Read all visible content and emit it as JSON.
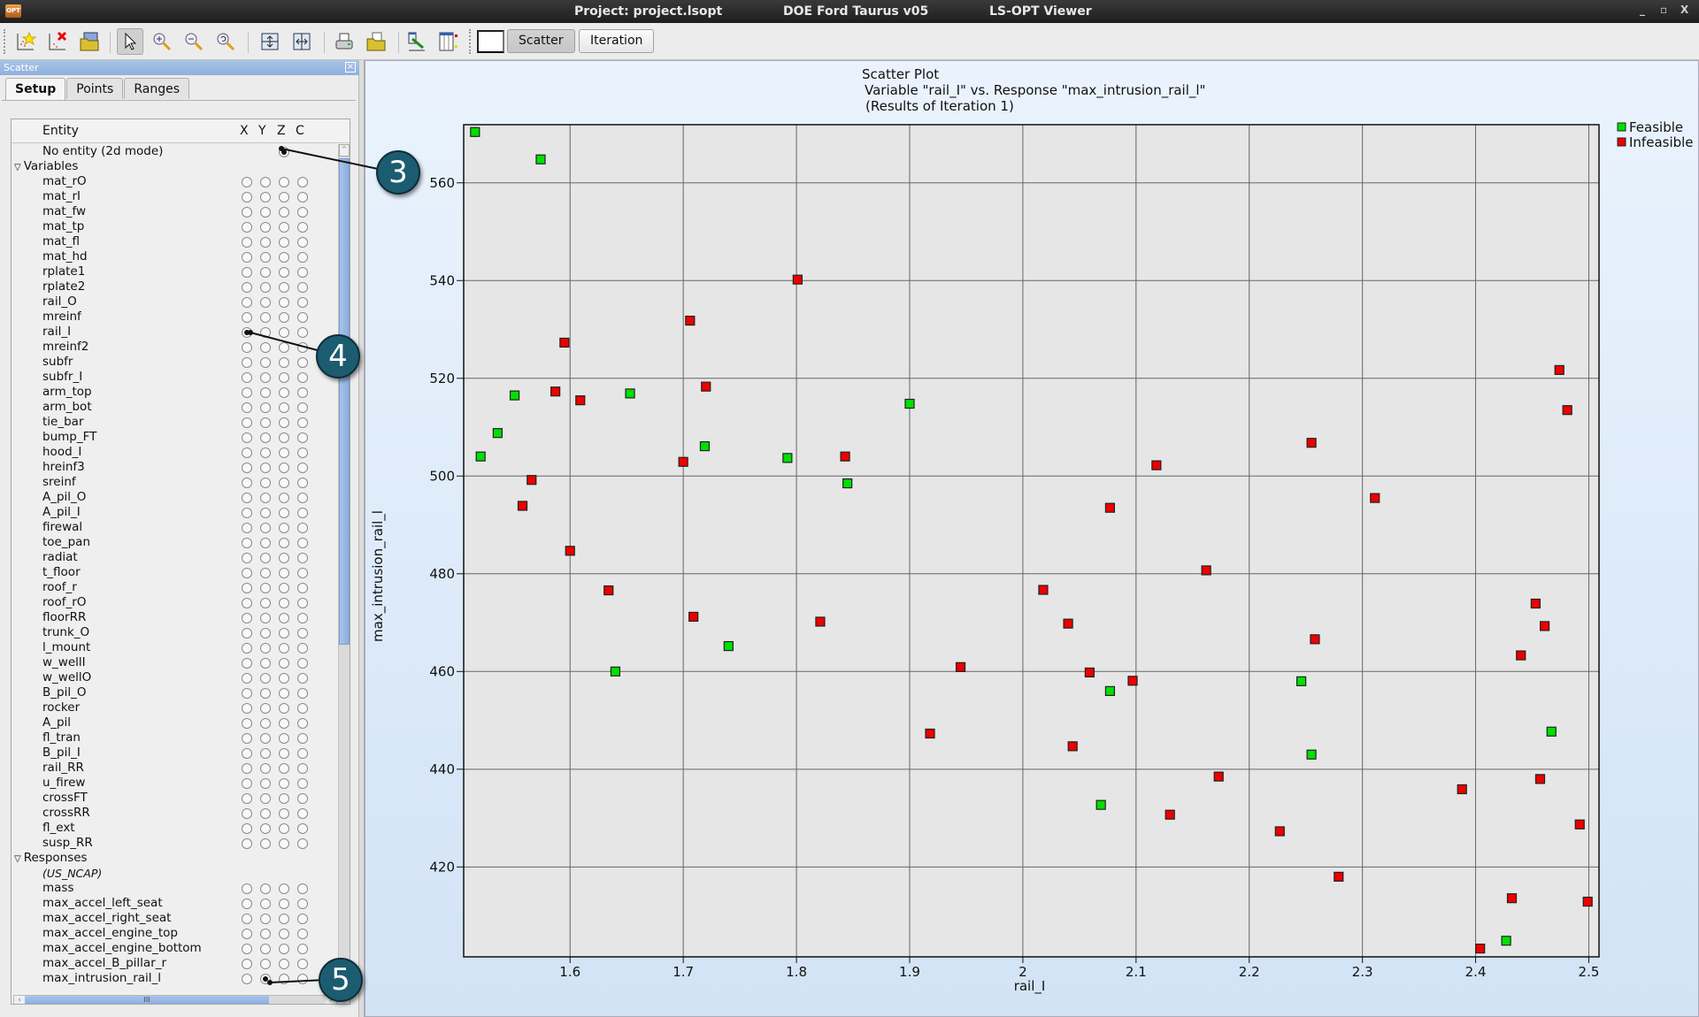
{
  "window": {
    "project": "Project: project.lsopt",
    "case": "DOE Ford Taurus v05",
    "app": "LS-OPT Viewer",
    "app_icon_text": "OPT",
    "controls": {
      "minimize": "_",
      "maximize": "▫",
      "close": "X"
    }
  },
  "toolbar": {
    "buttons": [
      {
        "name": "new-plot",
        "icon": "new-scatter-plot-icon"
      },
      {
        "name": "delete-plot",
        "icon": "delete-plot-icon"
      },
      {
        "name": "open",
        "icon": "folder-window-icon"
      },
      {
        "name": "select",
        "icon": "pointer-icon",
        "active": true
      },
      {
        "name": "zoom-in",
        "icon": "zoom-in-icon"
      },
      {
        "name": "zoom-out",
        "icon": "zoom-out-icon"
      },
      {
        "name": "zoom-reset",
        "icon": "zoom-reset-icon"
      },
      {
        "name": "fit-vertical",
        "icon": "fit-vertical-icon"
      },
      {
        "name": "fit-horizontal",
        "icon": "fit-horizontal-icon"
      },
      {
        "name": "print",
        "icon": "printer-icon"
      },
      {
        "name": "export",
        "icon": "export-folder-icon"
      },
      {
        "name": "link-plot",
        "icon": "link-plot-icon"
      },
      {
        "name": "table-view",
        "icon": "table-view-icon"
      }
    ],
    "color_swatch": "#ffffff",
    "scatter_label": "Scatter",
    "iteration_label": "Iteration"
  },
  "panel": {
    "title": "Scatter",
    "tabs": [
      "Setup",
      "Points",
      "Ranges"
    ],
    "selected_tab": "Setup",
    "columns": {
      "entity": "Entity",
      "x": "X",
      "y": "Y",
      "z": "Z",
      "c": "C"
    },
    "no_entity_label": "No entity (2d mode)",
    "no_entity_z_selected": true,
    "variables_group": "Variables",
    "variables": [
      "mat_rO",
      "mat_rI",
      "mat_fw",
      "mat_tp",
      "mat_fl",
      "mat_hd",
      "rplate1",
      "rplate2",
      "rail_O",
      "mreinf",
      "rail_I",
      "mreinf2",
      "subfr",
      "subfr_I",
      "arm_top",
      "arm_bot",
      "tie_bar",
      "bump_FT",
      "hood_I",
      "hreinf3",
      "sreinf",
      "A_pil_O",
      "A_pil_I",
      "firewal",
      "toe_pan",
      "radiat",
      "t_floor",
      "roof_r",
      "roof_rO",
      "floorRR",
      "trunk_O",
      "l_mount",
      "w_wellI",
      "w_wellO",
      "B_pil_O",
      "rocker",
      "A_pil",
      "fl_tran",
      "B_pil_I",
      "rail_RR",
      "u_firew",
      "crossFT",
      "crossRR",
      "fl_ext",
      "susp_RR"
    ],
    "x_selected": "rail_I",
    "responses_group": "Responses",
    "responses_subgroup": "(US_NCAP)",
    "responses": [
      "mass",
      "max_accel_left_seat",
      "max_accel_right_seat",
      "max_accel_engine_top",
      "max_accel_engine_bottom",
      "max_accel_B_pillar_r",
      "max_intrusion_rail_l"
    ],
    "y_selected": "max_intrusion_rail_l",
    "hscroll_grip": "III"
  },
  "callouts": [
    "3",
    "4",
    "5"
  ],
  "chart_data": {
    "type": "scatter",
    "title": "Scatter Plot",
    "subtitle": "Variable \"rail_I\" vs. Response \"max_intrusion_rail_l\"",
    "subtitle2": "(Results of Iteration 1)",
    "xlabel": "rail_I",
    "ylabel": "max_intrusion_rail_l",
    "xlim": [
      1.506,
      2.509
    ],
    "ylim": [
      401.6,
      571.9
    ],
    "xticks": [
      1.6,
      1.7,
      1.8,
      1.9,
      2,
      2.1,
      2.2,
      2.3,
      2.4,
      2.5
    ],
    "xtick_labels": [
      "1.6",
      "1.7",
      "1.8",
      "1.9",
      "2",
      "2.1",
      "2.2",
      "2.3",
      "2.4",
      "2.5"
    ],
    "yticks": [
      420,
      440,
      460,
      480,
      500,
      520,
      540,
      560
    ],
    "ytick_labels": [
      "420",
      "440",
      "460",
      "480",
      "500",
      "520",
      "540",
      "560"
    ],
    "grid": true,
    "legend_position": "top-right",
    "series": [
      {
        "name": "Feasible",
        "color": "#00e000",
        "points": [
          [
            1.516,
            570.4
          ],
          [
            1.574,
            564.8
          ],
          [
            1.551,
            516.5
          ],
          [
            1.653,
            516.9
          ],
          [
            1.536,
            508.8
          ],
          [
            1.521,
            504.0
          ],
          [
            1.719,
            506.1
          ],
          [
            1.792,
            503.7
          ],
          [
            1.9,
            514.8
          ],
          [
            1.845,
            498.5
          ],
          [
            1.74,
            465.2
          ],
          [
            1.64,
            460.0
          ],
          [
            2.077,
            456.0
          ],
          [
            2.069,
            432.7
          ],
          [
            2.246,
            458.0
          ],
          [
            2.467,
            447.7
          ],
          [
            2.255,
            443.0
          ],
          [
            2.427,
            404.9
          ]
        ]
      },
      {
        "name": "Infeasible",
        "color": "#ee0000",
        "points": [
          [
            1.801,
            540.2
          ],
          [
            1.706,
            531.8
          ],
          [
            1.595,
            527.3
          ],
          [
            1.72,
            518.3
          ],
          [
            1.587,
            517.3
          ],
          [
            1.609,
            515.5
          ],
          [
            1.7,
            502.9
          ],
          [
            1.566,
            499.2
          ],
          [
            1.558,
            493.9
          ],
          [
            1.843,
            504.0
          ],
          [
            2.118,
            502.2
          ],
          [
            2.077,
            493.5
          ],
          [
            1.6,
            484.7
          ],
          [
            1.634,
            476.6
          ],
          [
            1.709,
            471.2
          ],
          [
            1.821,
            470.2
          ],
          [
            1.945,
            460.9
          ],
          [
            1.918,
            447.3
          ],
          [
            2.018,
            476.7
          ],
          [
            2.04,
            469.8
          ],
          [
            2.059,
            459.8
          ],
          [
            2.097,
            458.1
          ],
          [
            2.044,
            444.7
          ],
          [
            2.13,
            430.7
          ],
          [
            2.162,
            480.7
          ],
          [
            2.173,
            438.5
          ],
          [
            2.474,
            521.7
          ],
          [
            2.481,
            513.5
          ],
          [
            2.255,
            506.8
          ],
          [
            2.311,
            495.5
          ],
          [
            2.453,
            473.9
          ],
          [
            2.461,
            469.3
          ],
          [
            2.44,
            463.3
          ],
          [
            2.258,
            466.6
          ],
          [
            2.457,
            438.0
          ],
          [
            2.388,
            435.9
          ],
          [
            2.227,
            427.3
          ],
          [
            2.492,
            428.7
          ],
          [
            2.279,
            418.0
          ],
          [
            2.432,
            413.6
          ],
          [
            2.499,
            412.9
          ],
          [
            2.404,
            403.3
          ]
        ]
      }
    ]
  }
}
